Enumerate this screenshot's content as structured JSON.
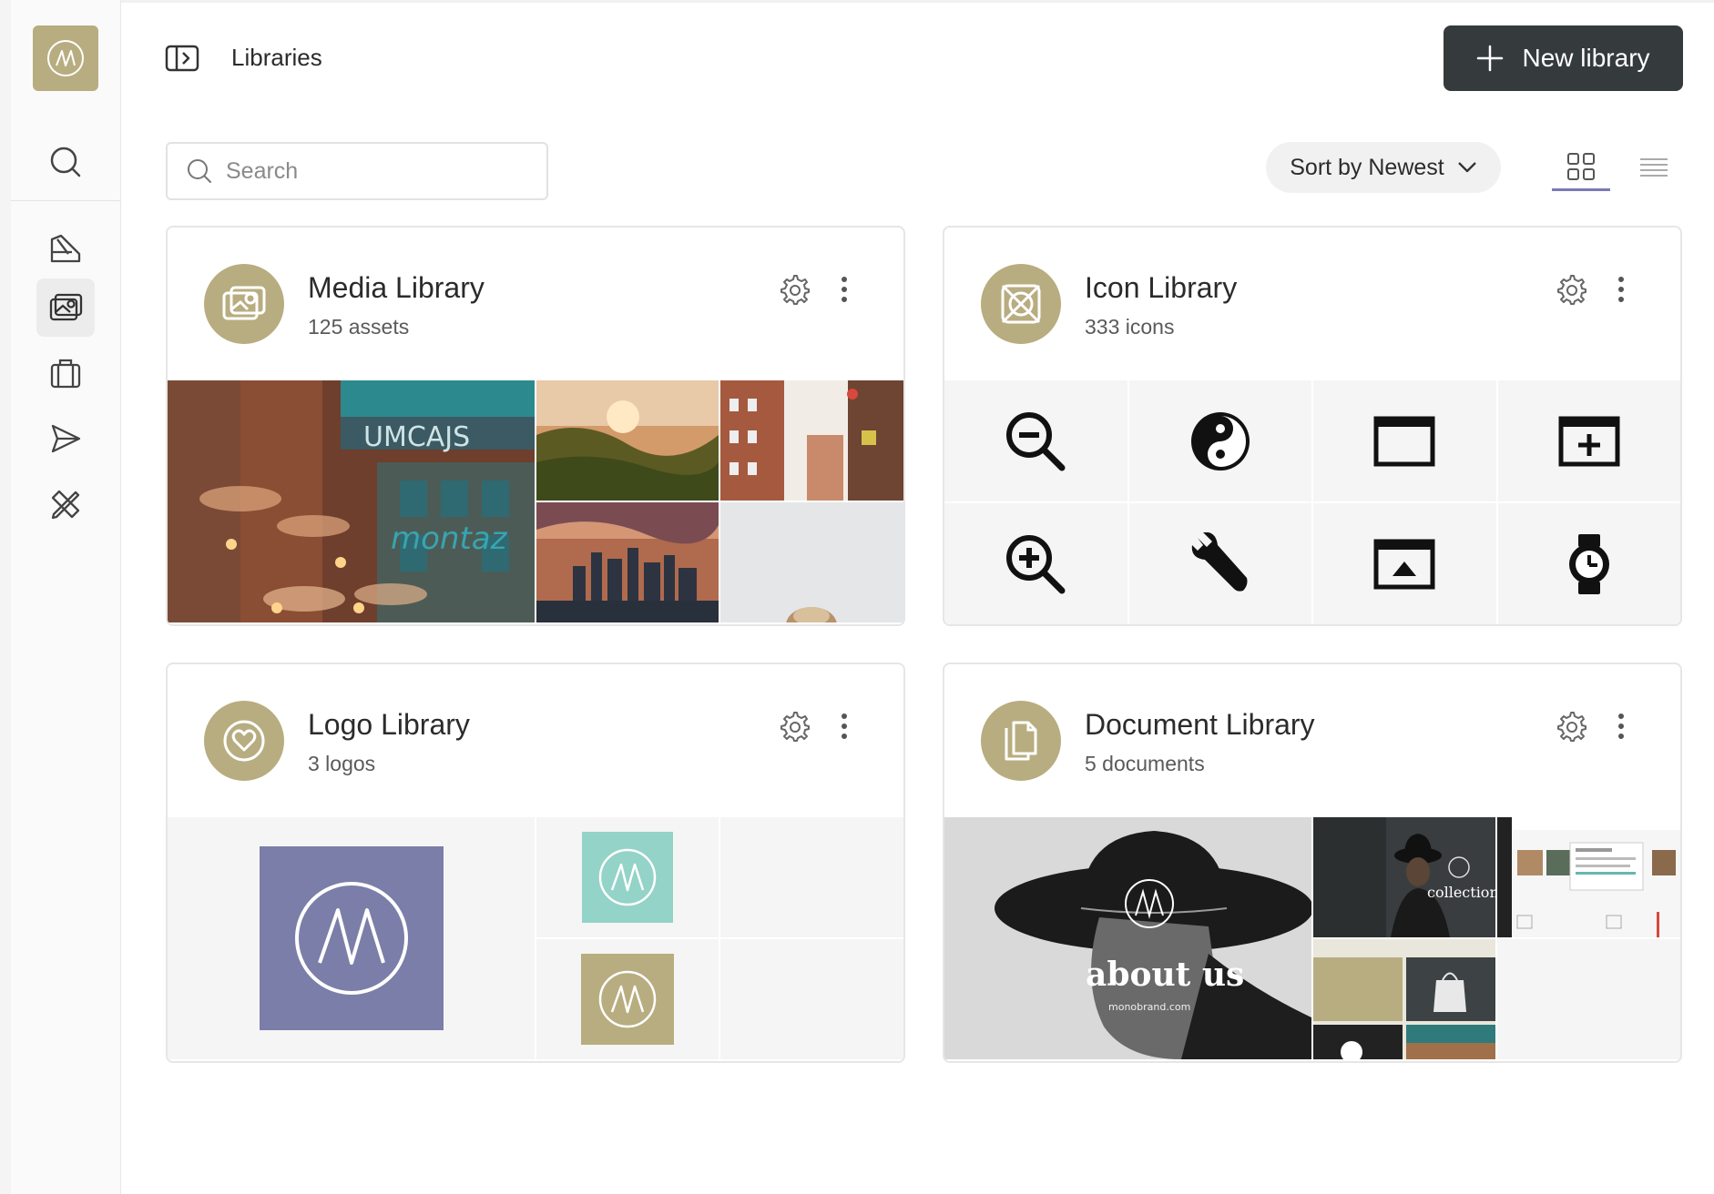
{
  "page": {
    "title": "Libraries"
  },
  "header": {
    "new_button_label": "New library"
  },
  "toolbar": {
    "search_placeholder": "Search",
    "sort_label": "Sort by Newest",
    "view_options": [
      "grid-view-icon",
      "list-view-icon"
    ],
    "active_view": "grid"
  },
  "sidebar": {
    "items": [
      {
        "icon": "search-icon"
      },
      {
        "icon": "palette-icon"
      },
      {
        "icon": "media-library-icon",
        "active": true
      },
      {
        "icon": "briefcase-icon"
      },
      {
        "icon": "send-icon"
      },
      {
        "icon": "design-tools-icon"
      }
    ]
  },
  "libraries": [
    {
      "name": "Media Library",
      "count": "125 assets",
      "icon": "image-icon"
    },
    {
      "name": "Icon Library",
      "count": "333 icons",
      "icon": "icon-frame-icon",
      "preview_icons": [
        "zoom-out-icon",
        "yin-yang-icon",
        "window-icon",
        "add-window-icon",
        "zoom-in-icon",
        "wrench-icon",
        "upload-window-icon",
        "watch-icon"
      ]
    },
    {
      "name": "Logo Library",
      "count": "3 logos",
      "icon": "heart-icon"
    },
    {
      "name": "Document Library",
      "count": "5 documents",
      "icon": "documents-icon",
      "preview_text": {
        "about": "about us",
        "site": "monobrand.com",
        "collection": "collection"
      }
    }
  ],
  "colors": {
    "accent": "#b8ad80",
    "button_dark": "#353a3d",
    "logo_purple": "#7b7ea8",
    "logo_teal": "#94d3c7",
    "active_tab_underline": "#7b79b5"
  }
}
